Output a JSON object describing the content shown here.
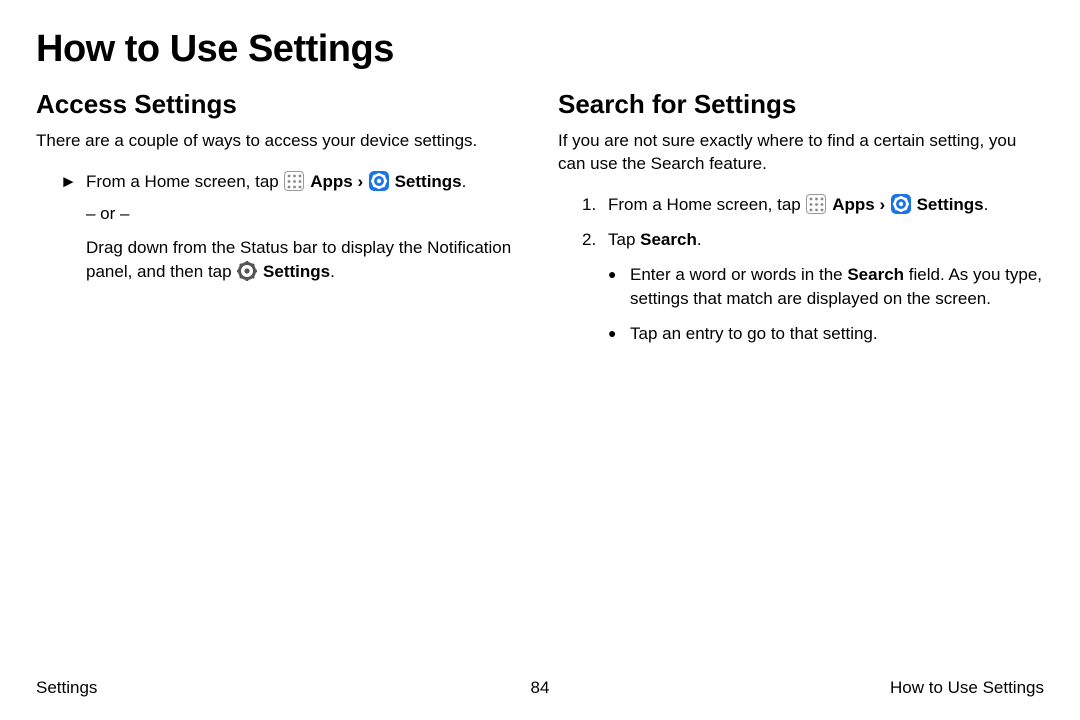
{
  "page_title": "How to Use Settings",
  "left": {
    "heading": "Access Settings",
    "intro": "There are a couple of ways to access your device settings.",
    "step_prefix": "From a Home screen, tap ",
    "apps_label": "Apps",
    "caret": "›",
    "settings_label": "Settings",
    "period": ".",
    "or_text": "– or –",
    "alt_prefix": "Drag down from the Status bar to display the Notification panel, and then tap ",
    "alt_settings": "Settings",
    "alt_period": "."
  },
  "right": {
    "heading": "Search for Settings",
    "intro": "If you are not sure exactly where to find a certain setting, you can use the Search feature.",
    "step1_num": "1.",
    "step1_prefix": "From a Home screen, tap ",
    "apps_label": "Apps",
    "caret": "›",
    "settings_label": "Settings",
    "period": ".",
    "step2_num": "2.",
    "step2_prefix": "Tap ",
    "search_label": "Search",
    "bullet1_prefix": "Enter a word or words in the ",
    "bullet1_bold": "Search",
    "bullet1_suffix": " field. As you type, settings that match are displayed on the screen.",
    "bullet2": "Tap an entry to go to that setting."
  },
  "footer": {
    "left": "Settings",
    "center": "84",
    "right": "How to Use Settings"
  }
}
